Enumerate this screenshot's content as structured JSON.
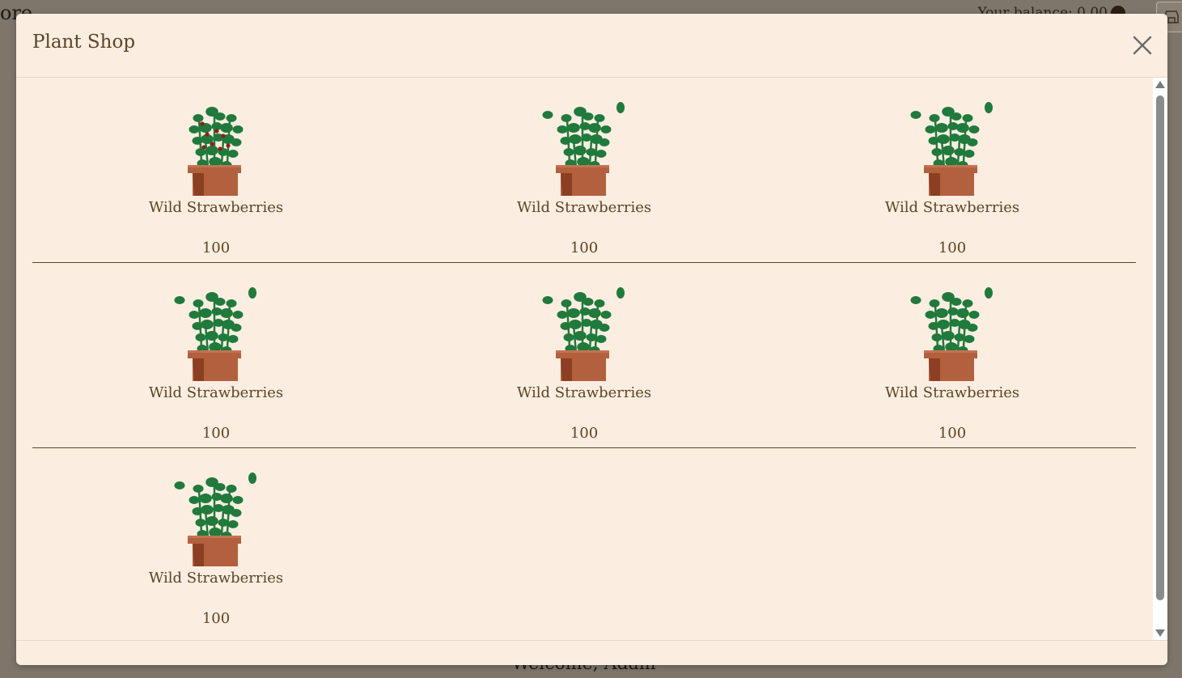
{
  "background": {
    "title": "ore",
    "balance": "Your balance: 0.00",
    "welcome": "Welcome, Adam"
  },
  "modal": {
    "title": "Plant Shop",
    "close_icon": "close-icon"
  },
  "plants": [
    {
      "name": "Wild Strawberries",
      "price": "100",
      "variant": "berries"
    },
    {
      "name": "Wild Strawberries",
      "price": "100",
      "variant": "plain"
    },
    {
      "name": "Wild Strawberries",
      "price": "100",
      "variant": "plain"
    },
    {
      "name": "Wild Strawberries",
      "price": "100",
      "variant": "plain"
    },
    {
      "name": "Wild Strawberries",
      "price": "100",
      "variant": "plain"
    },
    {
      "name": "Wild Strawberries",
      "price": "100",
      "variant": "plain"
    },
    {
      "name": "Wild Strawberries",
      "price": "100",
      "variant": "plain"
    }
  ],
  "colors": {
    "modal_bg": "#fbeee0",
    "text": "#5a4526",
    "leaf": "#1f7a3c",
    "pot": "#b3603f",
    "berry": "#8e1e1e"
  }
}
